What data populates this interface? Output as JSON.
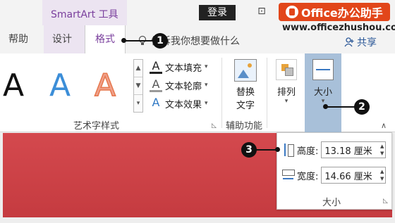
{
  "titlebar": {
    "context_tab": "SmartArt 工具",
    "login": "登录",
    "restore_glyph": "⊡",
    "brand": "Office办公助手",
    "website": "www.officezhushou.com"
  },
  "tabs": {
    "help": "帮助",
    "design": "设计",
    "format": "格式",
    "tell_me": "告诉我你想要做什么",
    "share": "共享"
  },
  "ribbon": {
    "wordart_letter": "A",
    "gallery_scroll": [
      "▲",
      "▼",
      "▾"
    ],
    "text_fill": "文本填充",
    "text_outline": "文本轮廓",
    "text_effect": "文本效果",
    "wordart_group": "艺术字样式",
    "alt_text_line1": "替换",
    "alt_text_line2": "文字",
    "accessibility_group": "辅助功能",
    "arrange": "排列",
    "size": "大小"
  },
  "size_popup": {
    "height_label": "高度:",
    "height_value": "13.18 厘米",
    "width_label": "宽度:",
    "width_value": "14.66 厘米",
    "group_label": "大小"
  },
  "callouts": {
    "c1": "1",
    "c2": "2",
    "c3": "3"
  },
  "colors": {
    "context_purple": "#7a3f9d",
    "size_selected": "#a8c0d9",
    "slide_red": "#c53b40",
    "brand_orange": "#e2461a"
  }
}
